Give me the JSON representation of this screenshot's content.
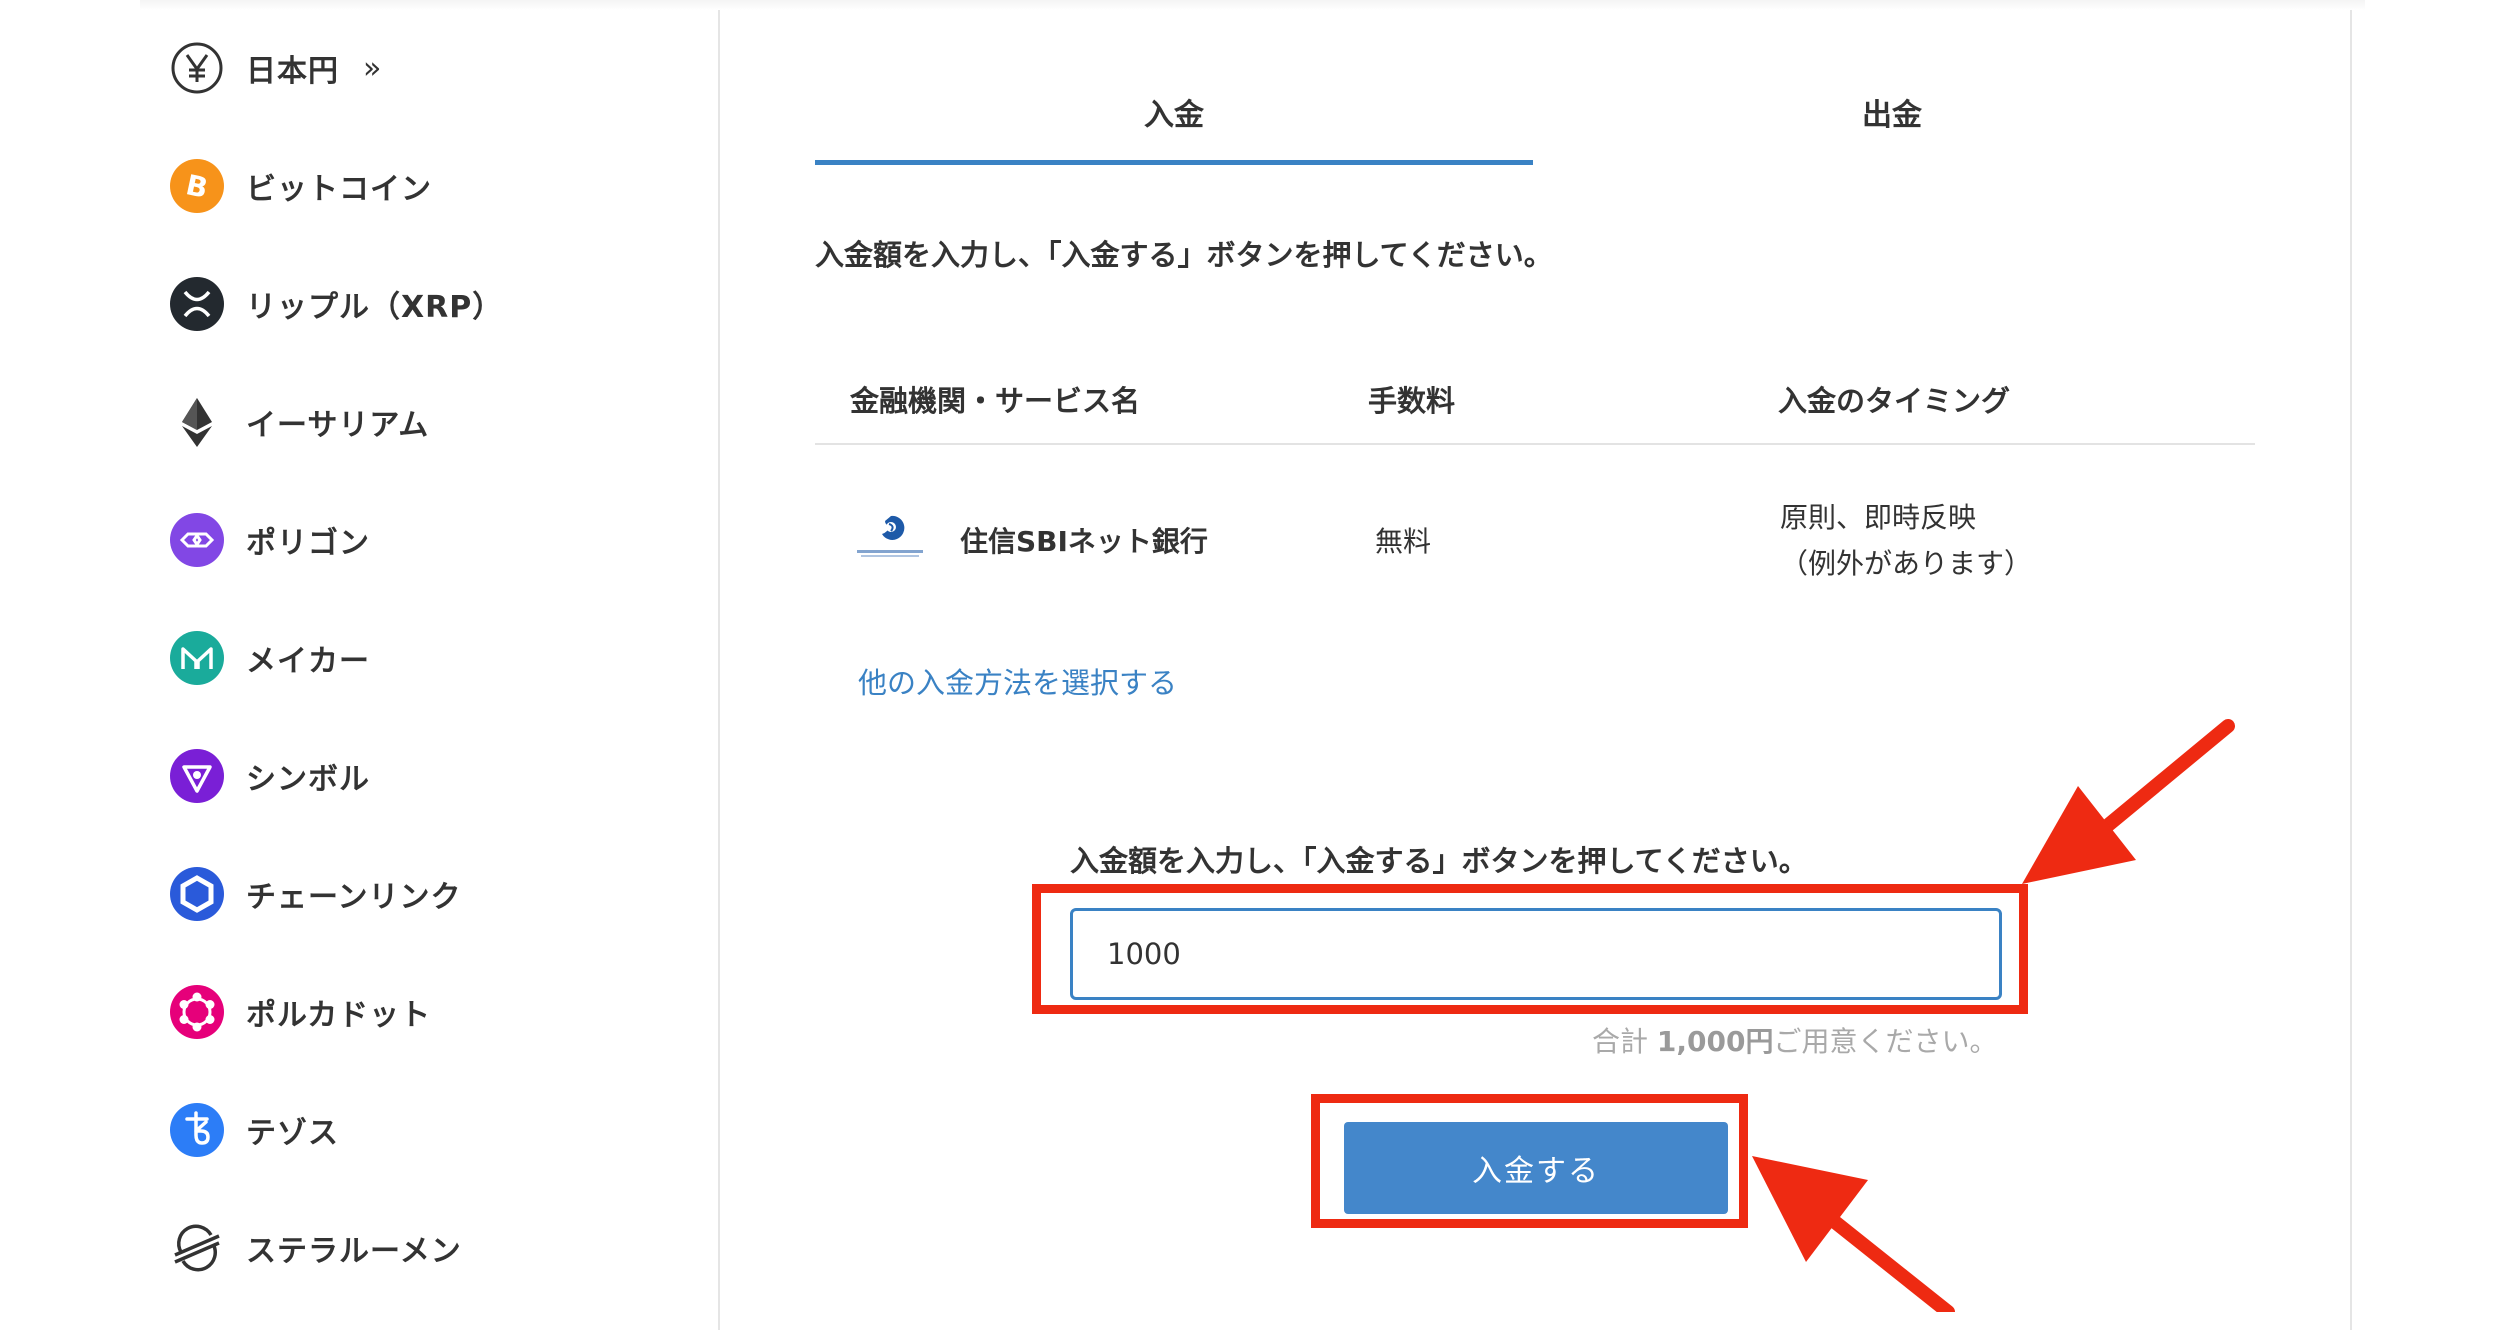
{
  "sidebar": {
    "items": [
      {
        "label": "日本円",
        "icon": "yen-icon",
        "chevron": "»"
      },
      {
        "label": "ビットコイン",
        "icon": "bitcoin-icon"
      },
      {
        "label": "リップル（XRP）",
        "icon": "xrp-icon"
      },
      {
        "label": "イーサリアム",
        "icon": "ethereum-icon"
      },
      {
        "label": "ポリゴン",
        "icon": "polygon-icon"
      },
      {
        "label": "メイカー",
        "icon": "maker-icon"
      },
      {
        "label": "シンボル",
        "icon": "symbol-icon"
      },
      {
        "label": "チェーンリンク",
        "icon": "chainlink-icon"
      },
      {
        "label": "ポルカドット",
        "icon": "polkadot-icon"
      },
      {
        "label": "テゾス",
        "icon": "tezos-icon"
      },
      {
        "label": "ステラルーメン",
        "icon": "stellar-icon"
      }
    ]
  },
  "tabs": {
    "deposit": "入金",
    "withdraw": "出金",
    "active": "deposit"
  },
  "instruction_top": "入金額を入力し、「入金する」ボタンを押してください。",
  "table": {
    "headers": [
      "金融機関・サービス名",
      "手数料",
      "入金のタイミング"
    ],
    "row": {
      "bank": "住信SBIネット銀行",
      "fee": "無料",
      "timing_line1": "原則、即時反映",
      "timing_line2": "（例外があります）"
    }
  },
  "other_methods_link": "他の入金方法を選択する",
  "form": {
    "instruction": "入金額を入力し、「入金する」ボタンを押してください。",
    "amount_value": "1000",
    "total_prefix": "合計 ",
    "total_amount": "1,000",
    "total_unit": "円",
    "total_suffix": "ご用意ください。",
    "submit_label": "入金する"
  },
  "colors": {
    "accent": "#3a82c4",
    "button": "#4487cb",
    "annotation_red": "#ee2a12",
    "bitcoin": "#f7931a",
    "xrp": "#23292f",
    "polygon": "#8247e5",
    "maker": "#1aab9b",
    "symbol": "#7a1fd6",
    "chainlink": "#2a5ada",
    "polkadot": "#e6007a",
    "tezos": "#2c7df7"
  }
}
